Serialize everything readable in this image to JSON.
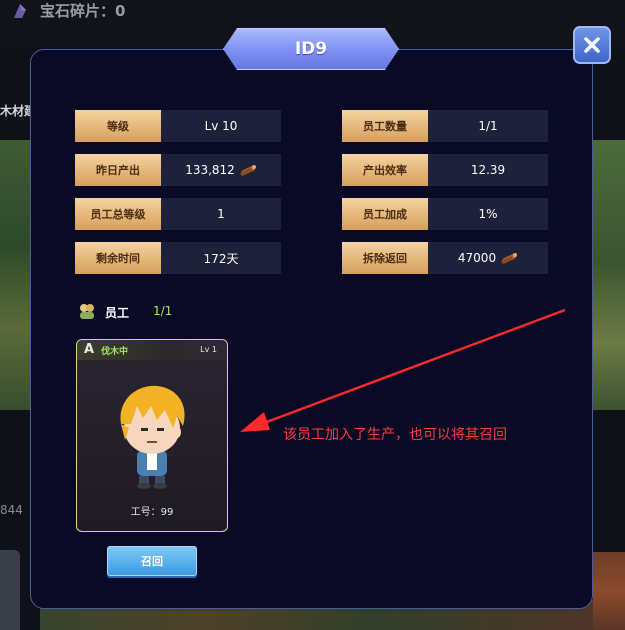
{
  "background": {
    "gem_fragments_text": "宝石碎片：0",
    "cut_label": "木材建",
    "cut_number": "844"
  },
  "panel": {
    "title": "ID9",
    "close_icon": "close-icon"
  },
  "stats": {
    "left": [
      {
        "label": "等级",
        "value": "Lv 10"
      },
      {
        "label": "昨日产出",
        "value": "133,812",
        "icon": "wood-icon"
      },
      {
        "label": "员工总等级",
        "value": "1"
      },
      {
        "label": "剩余时间",
        "value": "172天"
      }
    ],
    "right": [
      {
        "label": "员工数量",
        "value": "1/1"
      },
      {
        "label": "产出效率",
        "value": "12.39"
      },
      {
        "label": "员工加成",
        "value": "1%"
      },
      {
        "label": "拆除返回",
        "value": "47000",
        "icon": "wood-icon"
      }
    ]
  },
  "staff": {
    "label": "员工",
    "count": "1/1",
    "card": {
      "rank": "A",
      "status": "伐木中",
      "level": "Lv 1",
      "id_text": "工号：99"
    },
    "recall_button": "召回"
  },
  "annotation": "该员工加入了生产，也可以将其召回",
  "colors": {
    "panel_bg": "#0a0a26",
    "label_gold": "#d69f5b",
    "status_green": "#a8e06a",
    "annotation_red": "#ff3b3b",
    "button_blue": "#3e9ae2"
  }
}
